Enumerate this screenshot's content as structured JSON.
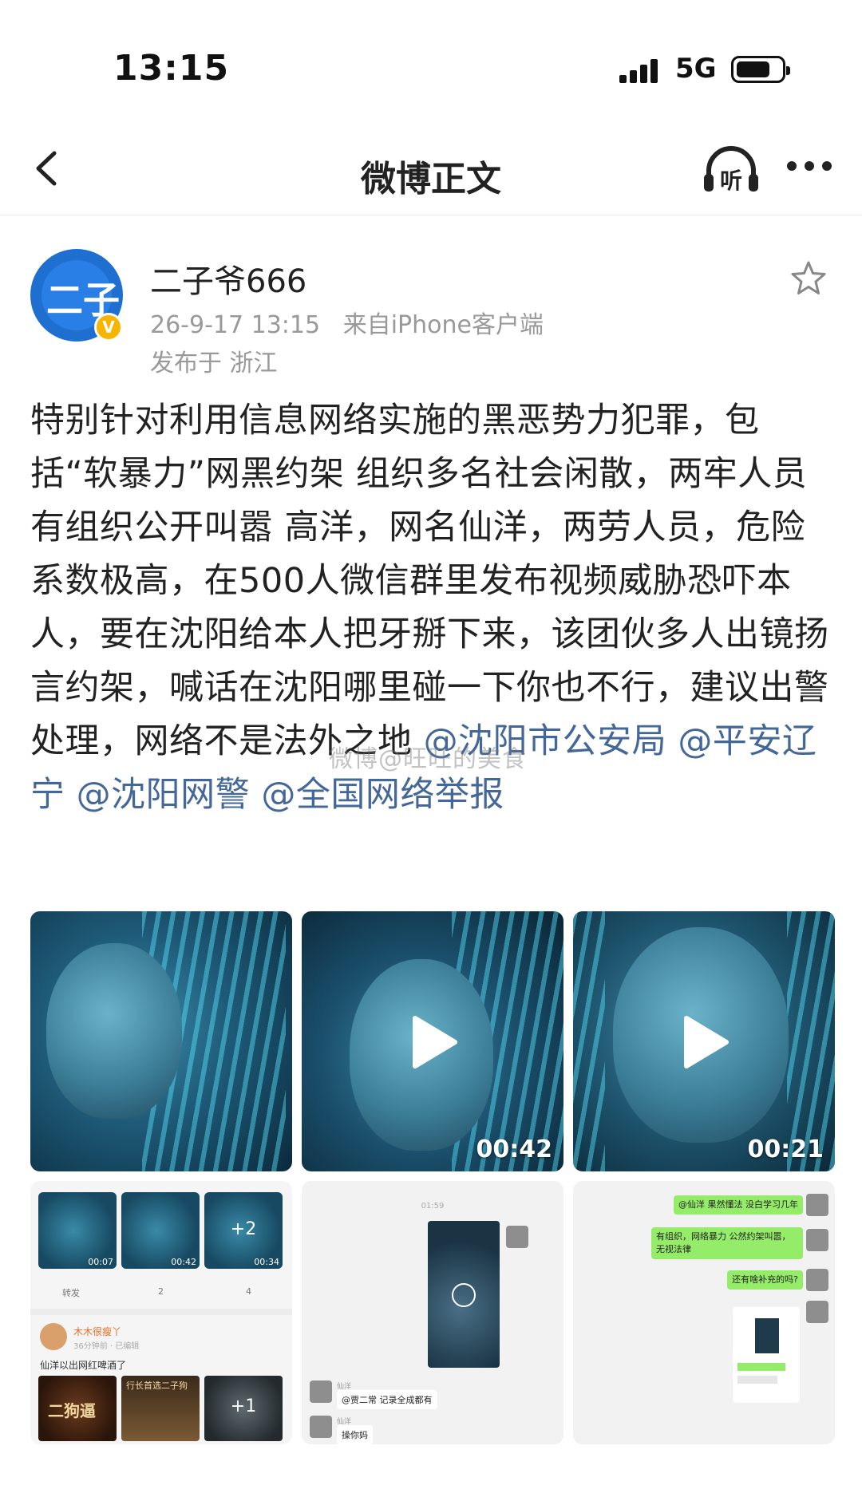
{
  "status_bar": {
    "time": "13:15",
    "network": "5G",
    "battery_level": 0.75
  },
  "nav": {
    "title": "微博正文",
    "back_icon": "chevron-left-icon",
    "listen_icon": "headphones-listen-icon",
    "listen_label": "听",
    "more_icon": "more-dots-icon"
  },
  "post": {
    "username": "二子爷666",
    "verified": true,
    "avatar_text": "二子",
    "date": "26-9-17 13:15",
    "source_prefix": "来自",
    "source": "iPhone客户端",
    "location": "发布于 浙江",
    "body_text": "特别针对利用信息网络实施的黑恶势力犯罪，包括“软暴力”网黑约架 组织多名社会闲散，两牢人员 有组织公开叫嚣 高洋，网名仙洋，两劳人员，危险系数极高，在500人微信群里发布视频威胁恐吓本人，要在沈阳给本人把牙掰下来，该团伙多人出镜扬言约架，喊话在沈阳哪里碰一下你也不行，建议出警处理，网络不是法外之地",
    "mentions": [
      "@沈阳市公安局",
      "@平安辽宁",
      "@沈阳网警",
      "@全国网络举报"
    ],
    "watermark": "微博@旺旺的美食"
  },
  "media": {
    "video2_duration": "00:42",
    "video3_duration": "00:21",
    "screenshot1": {
      "mini_durations": [
        "00:07",
        "00:42",
        "00:34"
      ],
      "mini_plus": "+2",
      "actions": [
        "转发",
        "2",
        "4"
      ],
      "commenter": "木木很瘦丫",
      "comment_time": "36分钟前 · 已编辑",
      "comment_text": "仙洋以出网红啤酒了",
      "brand_name": "二狗逼",
      "brand_slogan": "行长首选二子狗",
      "plus_count": "+1"
    },
    "screenshot2": {
      "chat_time": "01:59",
      "sender": "仙洋",
      "msg1": "@贾二常 记录全成都有",
      "msg2": "操你妈"
    },
    "screenshot3": {
      "msg1": "@仙洋 果然懂法 没白学习几年",
      "msg2": "有组织，网络暴力 公然约架叫嚣，无视法律",
      "msg3": "还有啥补充的吗?"
    }
  }
}
